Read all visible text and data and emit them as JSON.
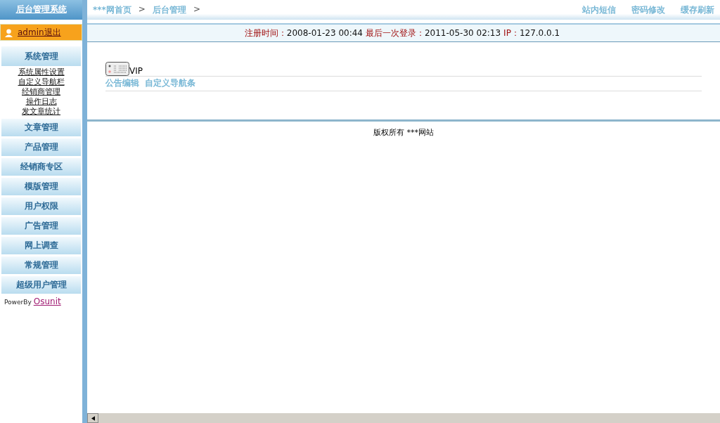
{
  "sidebar": {
    "title": "后台管理系统",
    "user_link": "admin退出",
    "groups": [
      {
        "label": "系统管理",
        "expanded": true,
        "items": [
          "系统属性设置",
          "自定义导航栏",
          "经销商管理",
          "操作日志",
          "发文章统计"
        ]
      },
      {
        "label": "文章管理",
        "expanded": false
      },
      {
        "label": "产品管理",
        "expanded": false
      },
      {
        "label": "经销商专区",
        "expanded": false
      },
      {
        "label": "模版管理",
        "expanded": false
      },
      {
        "label": "用户权限",
        "expanded": false
      },
      {
        "label": "广告管理",
        "expanded": false
      },
      {
        "label": "网上调查",
        "expanded": false
      },
      {
        "label": "常规管理",
        "expanded": false
      },
      {
        "label": "超级用户管理",
        "expanded": false
      }
    ],
    "powered_by": "PowerBy",
    "powered_link": "Osunit"
  },
  "breadcrumb": [
    "***网首页",
    ">",
    "后台管理",
    ">"
  ],
  "top_links": [
    "站内短信",
    "密码修改",
    "缓存刷新"
  ],
  "info_bar": [
    {
      "label": "注册时间：",
      "value": "2008-01-23 00:44"
    },
    {
      "label": "最后一次登录：",
      "value": "2011-05-30 02:13"
    },
    {
      "label": "IP：",
      "value": "127.0.0.1"
    }
  ],
  "content": {
    "heading": "VIP",
    "links": [
      "公告编辑",
      "自定义导航条"
    ]
  },
  "footer": "版权所有 ***网站"
}
